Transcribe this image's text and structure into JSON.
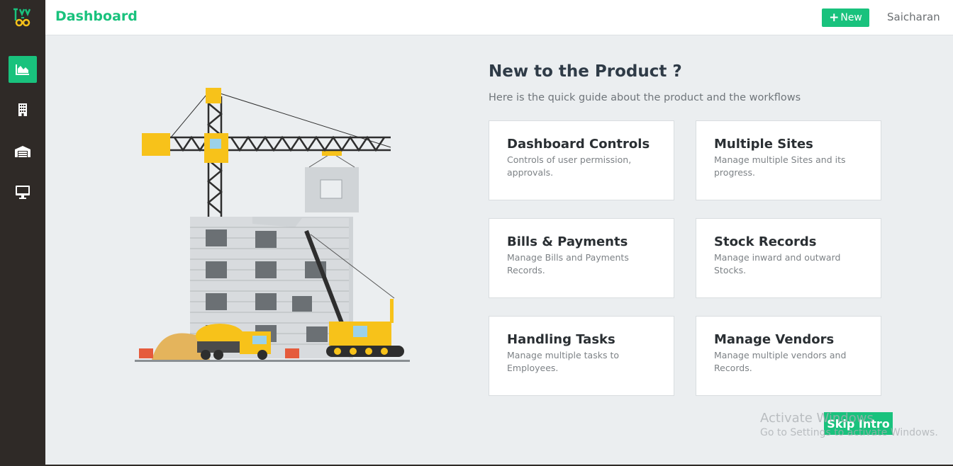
{
  "header": {
    "title": "Dashboard",
    "new_button_label": "New",
    "user_name": "Saicharan"
  },
  "sidebar": {
    "items": [
      {
        "icon": "chart-area-icon",
        "active": true
      },
      {
        "icon": "building-icon",
        "active": false
      },
      {
        "icon": "warehouse-icon",
        "active": false
      },
      {
        "icon": "desktop-icon",
        "active": false
      }
    ]
  },
  "intro": {
    "heading": "New to the Product ?",
    "subheading": "Here is the quick guide about the product and the workflows"
  },
  "cards": [
    {
      "title": "Dashboard Controls",
      "description": "Controls of user permission, approvals."
    },
    {
      "title": "Multiple Sites",
      "description": "Manage multiple Sites and its progress."
    },
    {
      "title": "Bills & Payments",
      "description": "Manage Bills and Payments Records."
    },
    {
      "title": "Stock Records",
      "description": "Manage inward and outward Stocks."
    },
    {
      "title": "Handling Tasks",
      "description": "Manage multiple tasks to Employees."
    },
    {
      "title": "Manage Vendors",
      "description": "Manage multiple vendors and Records."
    }
  ],
  "skip_button_label": "Skip Intro",
  "watermark": {
    "line1": "Activate Windows",
    "line2": "Go to Settings to activate Windows."
  },
  "colors": {
    "accent": "#19c27d",
    "sidebar": "#2f2a27",
    "background": "#ebeef0",
    "crane_yellow": "#f7c21a"
  }
}
